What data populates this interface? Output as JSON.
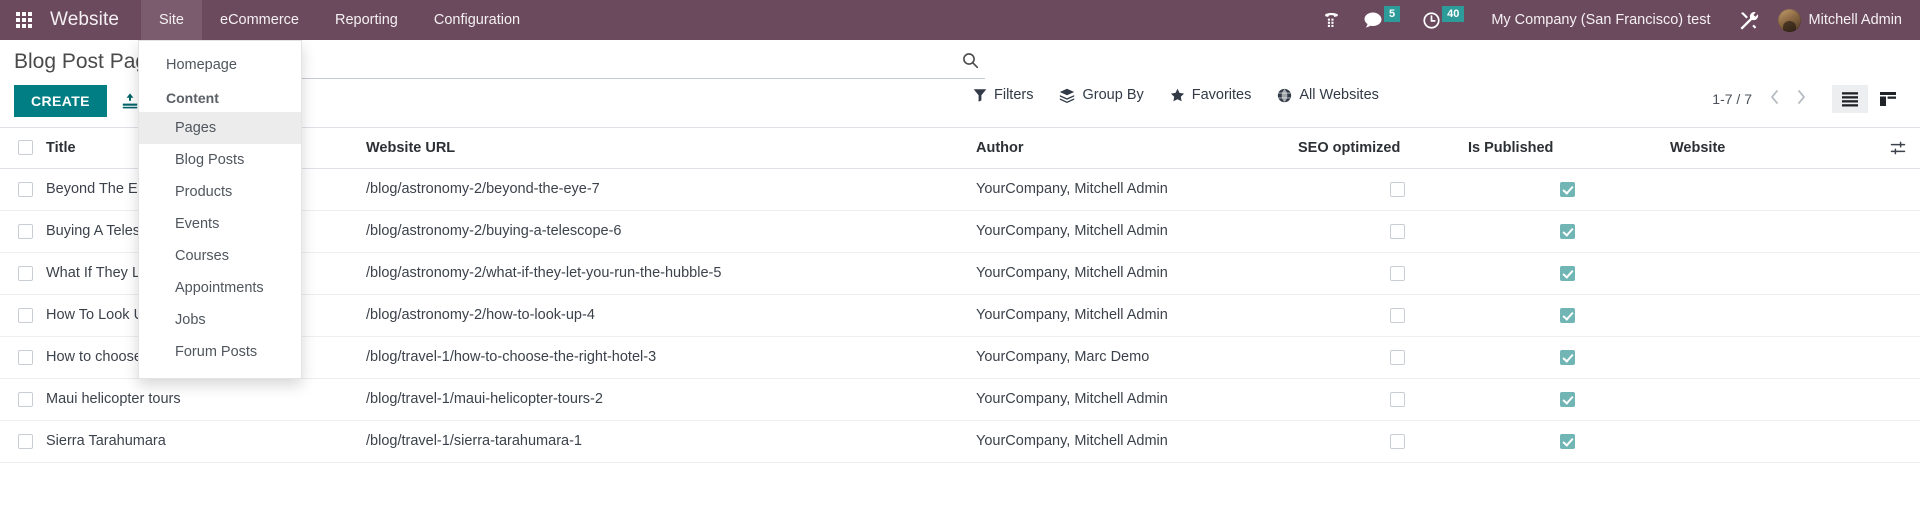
{
  "navbar": {
    "apps_icon": "apps-grid-icon",
    "brand": "Website",
    "menus": [
      {
        "label": "Site",
        "active": true
      },
      {
        "label": "eCommerce",
        "active": false
      },
      {
        "label": "Reporting",
        "active": false
      },
      {
        "label": "Configuration",
        "active": false
      }
    ],
    "systray": {
      "dialpad_icon": "phone-dialpad-icon",
      "messages_icon": "chat-bubble-icon",
      "messages_count": "5",
      "activities_icon": "clock-icon",
      "activities_count": "40",
      "debug_icon": "tools-wrench-icon",
      "badge_color": "#2e9b9b"
    },
    "company": "My Company (San Francisco) test",
    "user": "Mitchell Admin",
    "bar_color": "#6c4a5e"
  },
  "site_dropdown": {
    "homepage": "Homepage",
    "content_label": "Content",
    "items": [
      {
        "label": "Pages",
        "hovered": true
      },
      {
        "label": "Blog Posts",
        "hovered": false
      },
      {
        "label": "Products",
        "hovered": false
      },
      {
        "label": "Events",
        "hovered": false
      },
      {
        "label": "Courses",
        "hovered": false
      },
      {
        "label": "Appointments",
        "hovered": false
      },
      {
        "label": "Jobs",
        "hovered": false
      },
      {
        "label": "Forum Posts",
        "hovered": false
      }
    ]
  },
  "control_panel": {
    "breadcrumb": "Blog Post Pages",
    "create_label": "CREATE",
    "import_icon": "import-upload-icon",
    "search": {
      "placeholder": "Search...",
      "value": "",
      "icon": "search-icon"
    },
    "filters": [
      {
        "label": "Filters",
        "icon": "funnel-icon"
      },
      {
        "label": "Group By",
        "icon": "layers-icon"
      },
      {
        "label": "Favorites",
        "icon": "star-icon"
      },
      {
        "label": "All Websites",
        "icon": "globe-icon"
      }
    ],
    "pager": {
      "count": "1-7 / 7",
      "prev_icon": "chevron-left-icon",
      "next_icon": "chevron-right-icon"
    },
    "views": [
      {
        "name": "list",
        "icon": "list-view-icon",
        "active": true
      },
      {
        "name": "kanban",
        "icon": "kanban-view-icon",
        "active": false
      }
    ],
    "accent_color": "#017e84"
  },
  "table": {
    "headers": {
      "title": "Title",
      "url": "Website URL",
      "author": "Author",
      "seo": "SEO optimized",
      "published": "Is Published",
      "website": "Website",
      "optional_icon": "column-options-icon"
    },
    "rows": [
      {
        "title": "Beyond The Eye",
        "url": "/blog/astronomy-2/beyond-the-eye-7",
        "author": "YourCompany, Mitchell Admin",
        "seo": false,
        "published": true,
        "website": ""
      },
      {
        "title": "Buying A Telescope",
        "url": "/blog/astronomy-2/buying-a-telescope-6",
        "author": "YourCompany, Mitchell Admin",
        "seo": false,
        "published": true,
        "website": ""
      },
      {
        "title": "What If They Let You Run The Hubble",
        "url": "/blog/astronomy-2/what-if-they-let-you-run-the-hubble-5",
        "author": "YourCompany, Mitchell Admin",
        "seo": false,
        "published": true,
        "website": ""
      },
      {
        "title": "How To Look Up",
        "url": "/blog/astronomy-2/how-to-look-up-4",
        "author": "YourCompany, Mitchell Admin",
        "seo": false,
        "published": true,
        "website": ""
      },
      {
        "title": "How to choose the right hotel",
        "url": "/blog/travel-1/how-to-choose-the-right-hotel-3",
        "author": "YourCompany, Marc Demo",
        "seo": false,
        "published": true,
        "website": ""
      },
      {
        "title": "Maui helicopter tours",
        "url": "/blog/travel-1/maui-helicopter-tours-2",
        "author": "YourCompany, Mitchell Admin",
        "seo": false,
        "published": true,
        "website": ""
      },
      {
        "title": "Sierra Tarahumara",
        "url": "/blog/travel-1/sierra-tarahumara-1",
        "author": "YourCompany, Mitchell Admin",
        "seo": false,
        "published": true,
        "website": ""
      }
    ],
    "published_color": "#71b5b5"
  }
}
